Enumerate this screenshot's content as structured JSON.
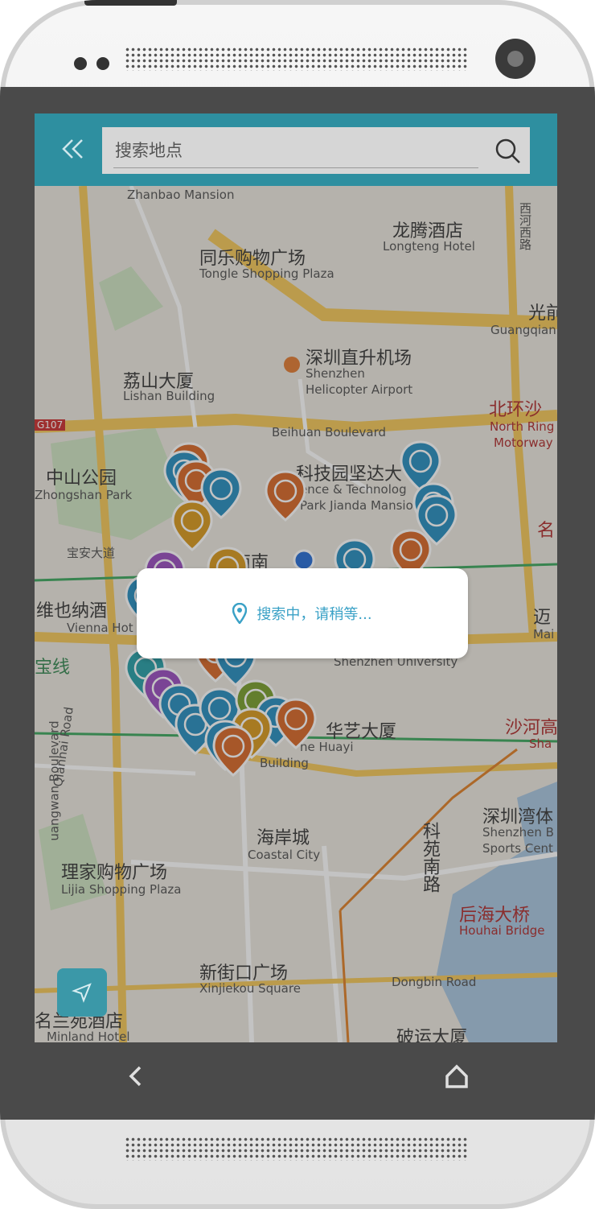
{
  "search": {
    "placeholder": "搜索地点",
    "value": ""
  },
  "dialog": {
    "message": "搜索中，请稍等..."
  },
  "map_labels": {
    "zhanbao": "Zhanbao Mansion",
    "longteng_cn": "龙腾酒店",
    "longteng_en": "Longteng Hotel",
    "tongle_cn": "同乐购物广场",
    "tongle_en": "Tongle Shopping Plaza",
    "guangqian": "Guangqian",
    "guang_cn": "光前",
    "airport_cn": "深圳直升机场",
    "airport_en1": "Shenzhen",
    "airport_en2": "Helicopter Airport",
    "lishan_cn": "荔山大厦",
    "lishan_en": "Lishan Building",
    "beihuan_cn": "北环沙",
    "beihuan_en1": "North Ring",
    "beihuan_en2": "Motorway",
    "beihuan_blvd": "Beihuan Boulevard",
    "g107": "G107",
    "zhongshan_cn": "中山公园",
    "zhongshan_en": "Zhongshan Park",
    "kejiyuan_cn": "科技园坚达大",
    "kejiyuan_en1": "ence & Technolog",
    "kejiyuan_en2": "Park Jianda Mansio",
    "baoan": "宝安大道",
    "shennan": "深南南",
    "ming": "名",
    "vienna_cn": "维也纳酒",
    "vienna_en": "Vienna Hot",
    "mai_cn": "迈",
    "mai_en": "Mai",
    "baoxian": "宝线",
    "szu": "Shenzhen University",
    "huayi_cn": "华艺大厦",
    "huayi_en": "ne Huayi",
    "building": "Building",
    "shahe_cn": "沙河高",
    "shahe_en": "Sha",
    "qianhai": "Qianhai Road",
    "longwan": "uangwan Boulevard",
    "shenzhenwan_cn": "深圳湾体",
    "shenzhenwan_en1": "Shenzhen B",
    "shenzhenwan_en2": "Sports Cent",
    "coastal_cn": "海岸城",
    "coastal_en": "Coastal City",
    "keyuan": "科苑南路",
    "lijia_cn": "理家购物广场",
    "lijia_en": "Lijia Shopping Plaza",
    "houhai_cn": "后海大桥",
    "houhai_en": "Houhai Bridge",
    "xinjiekou_cn": "新街口广场",
    "xinjiekou_en": "Xinjiekou Square",
    "dongbin": "Dongbin Road",
    "minland_cn": "名兰苑酒店",
    "minland_en": "Minland Hotel",
    "liufa": "西河西路",
    "pulang": "破运大厦"
  },
  "icons": [
    "back-double-chevron-icon",
    "search-icon",
    "location-pin-icon",
    "navigate-arrow-icon",
    "nav-back-icon",
    "nav-home-icon"
  ],
  "colors": {
    "topbar": "#2e8fa0",
    "accent": "#3aa1c6",
    "restaurant_pin": "#d86a2a",
    "shop_pin": "#2a8fc0"
  }
}
